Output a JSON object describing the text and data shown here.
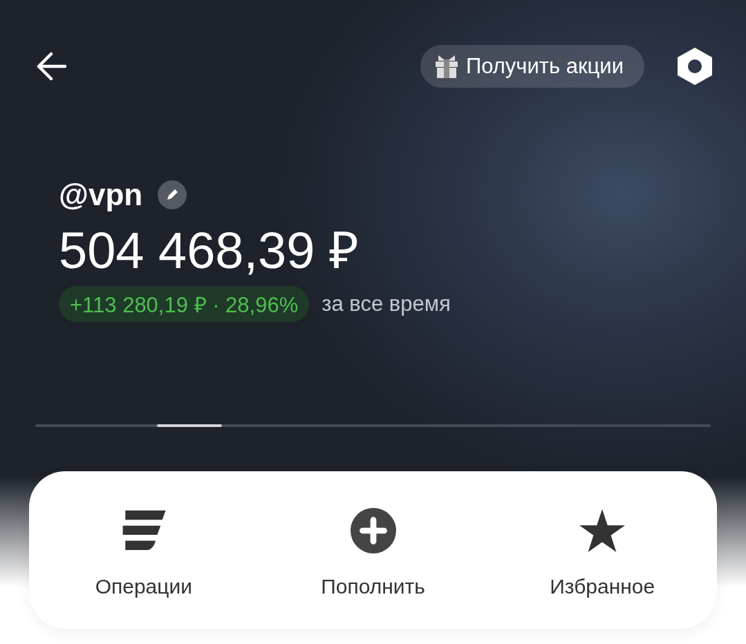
{
  "header": {
    "promo_button": "Получить акции"
  },
  "account": {
    "username": "@vpn",
    "balance": "504 468,39 ₽",
    "change": "+113 280,19 ₽ · 28,96%",
    "change_period": "за все время"
  },
  "actions": [
    {
      "label": "Операции"
    },
    {
      "label": "Пополнить"
    },
    {
      "label": "Избранное"
    }
  ]
}
